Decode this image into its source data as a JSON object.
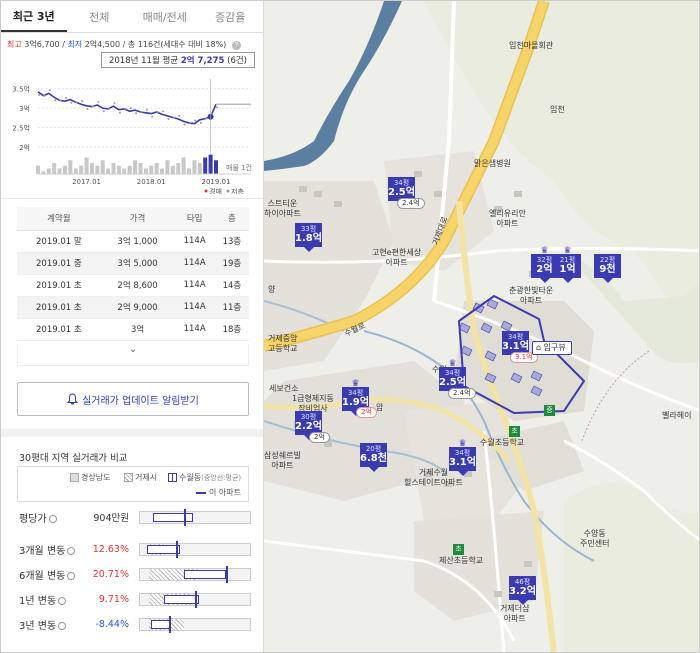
{
  "tabs": [
    {
      "label": "최근 3년",
      "active": true
    },
    {
      "label": "전체",
      "active": false
    },
    {
      "label": "매매/전세",
      "active": false
    },
    {
      "label": "증감율",
      "active": false
    }
  ],
  "summary": {
    "high_label": "최고",
    "high_value": "3억6,700",
    "sep": "/",
    "low_label": "최저",
    "low_value": "2억4,500",
    "count": "/ 총 116건(세대수 대비 18%)"
  },
  "tooltip": {
    "prefix": "2018년 11월 평균",
    "value": "2억 7,275",
    "count": "(6건)"
  },
  "chart_data": {
    "type": "line",
    "x": [
      "2016-04",
      "2016-05",
      "2016-06",
      "2016-07",
      "2016-08",
      "2016-09",
      "2016-10",
      "2016-11",
      "2016-12",
      "2017-01",
      "2017-02",
      "2017-03",
      "2017-04",
      "2017-05",
      "2017-06",
      "2017-07",
      "2017-08",
      "2017-09",
      "2017-10",
      "2017-11",
      "2017-12",
      "2018-01",
      "2018-02",
      "2018-03",
      "2018-04",
      "2018-05",
      "2018-06",
      "2018-07",
      "2018-08",
      "2018-09",
      "2018-10",
      "2018-11",
      "2018-12",
      "2019-01"
    ],
    "series": [
      {
        "values": [
          3.42,
          3.32,
          3.38,
          3.28,
          3.2,
          3.18,
          3.22,
          3.15,
          3.1,
          3.06,
          3.04,
          3.08,
          3.0,
          2.98,
          3.05,
          2.96,
          2.98,
          2.92,
          2.95,
          2.9,
          2.88,
          2.86,
          2.9,
          2.84,
          2.8,
          2.76,
          2.72,
          2.66,
          2.62,
          2.6,
          2.7,
          2.73,
          2.78,
          3.1
        ]
      }
    ],
    "volume": [
      3,
      1,
      2,
      4,
      2,
      3,
      5,
      2,
      3,
      6,
      4,
      3,
      5,
      2,
      4,
      3,
      2,
      3,
      5,
      4,
      2,
      3,
      4,
      2,
      5,
      3,
      4,
      6,
      2,
      5,
      4,
      6,
      7,
      5
    ],
    "yticks": [
      "3.5억",
      "3억",
      "2.5억",
      "2억"
    ],
    "ylim": [
      2,
      3.75
    ],
    "xticks": [
      "2017.01",
      "2018.01",
      "2019.01"
    ],
    "right_label": "매물 1건",
    "legend": [
      {
        "name": "경매",
        "color": "#d33"
      },
      {
        "name": "저층",
        "color": "#999"
      }
    ]
  },
  "table": {
    "headers": [
      "계약월",
      "가격",
      "타입",
      "층"
    ],
    "rows": [
      [
        "2019.01 말",
        "3억 1,000",
        "114A",
        "13층"
      ],
      [
        "2019.01 중",
        "3억 5,000",
        "114A",
        "19층"
      ],
      [
        "2019.01 초",
        "2억 8,600",
        "114A",
        "14층"
      ],
      [
        "2019.01 초",
        "2억 9,000",
        "114A",
        "11층"
      ],
      [
        "2019.01 초",
        "3억",
        "114A",
        "18층"
      ]
    ],
    "more": "⌄"
  },
  "alert_button": "실거래가 업데이트 알림받기",
  "compare": {
    "title": "30평대 지역 실거래가 비교",
    "legend": {
      "province": "경상남도",
      "city": "거제시",
      "dong": "수월동",
      "dong_note": "(중앙선:평균)",
      "this_apt": "이 아파트"
    },
    "rows": [
      {
        "label": "평당가",
        "value": "904만원",
        "color": "blk"
      },
      {
        "label": "3개월 변동",
        "value": "12.63%",
        "color": "red"
      },
      {
        "label": "6개월 변동",
        "value": "20.71%",
        "color": "red"
      },
      {
        "label": "1년 변동",
        "value": "9.71%",
        "color": "red"
      },
      {
        "label": "3년 변동",
        "value": "-8.44%",
        "color": "blue"
      }
    ]
  },
  "map": {
    "labels": {
      "imcheon_hall": "임천마을회관",
      "imcheon": "임천",
      "hospital": "맑은샘병원",
      "el_apt": "엘리유리안\n아파트",
      "goyh": "고현e편한세상\n아파트",
      "stay": "스트티운\n하이아파트",
      "chun": "춘광한빛타운\n아파트",
      "geoje_mid": "거제중앙\n고등학교",
      "yang": "양",
      "tech": "1급형제지동\n장비업사",
      "sebo": "세보건소",
      "samsung": "삼성쉐르빌\n아파트",
      "suwol_school": "수월초등학교",
      "suwol_hill": "거제수월\n힐스테이트아파트",
      "jesan": "제산초등학교",
      "suyang": "수양동\n주민센터",
      "geoje_sang": "거제더샵\n아파트",
      "bellahe": "벨라헤이",
      "sulwol": "수월",
      "geoje_ro": "거제대로",
      "suwol_ro": "수월로",
      "ap": "압"
    },
    "entrance": "입구뷰",
    "pins": [
      {
        "size": "34평",
        "price": "2.5억",
        "chip": "2.4억"
      },
      {
        "size": "33평",
        "price": "1.8억"
      },
      {
        "size": "32평",
        "price": "2억"
      },
      {
        "size": "21평",
        "price": "1억"
      },
      {
        "size": "22평",
        "price": "9천"
      },
      {
        "size": "34평",
        "price": "3.1억",
        "chip": "3.1억"
      },
      {
        "size": "34평",
        "price": "2.5억",
        "chip": "2.4억"
      },
      {
        "size": "34평",
        "price": "1.9억",
        "chip": "2억"
      },
      {
        "size": "30평",
        "price": "2.2억",
        "chip": "2억"
      },
      {
        "size": "20평",
        "price": "6.8천"
      },
      {
        "size": "34평",
        "price": "3.1억"
      },
      {
        "size": "46평",
        "price": "3.2억"
      }
    ],
    "badges": [
      "초",
      "중",
      "초"
    ],
    "colors": {
      "pin": "#3b3bb0",
      "water": "#5b7fa0",
      "road": "#f5c85a",
      "green": "#dfe8d3"
    }
  }
}
